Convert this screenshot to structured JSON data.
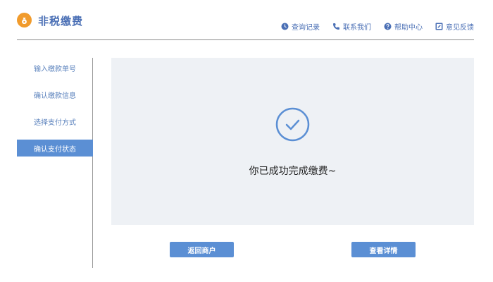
{
  "header": {
    "title": "非税缴费",
    "logo_icon": "money-bag-icon",
    "nav": [
      {
        "label": "查询记录",
        "icon": "clock-icon"
      },
      {
        "label": "联系我们",
        "icon": "phone-icon"
      },
      {
        "label": "帮助中心",
        "icon": "help-icon"
      },
      {
        "label": "意见反馈",
        "icon": "edit-icon"
      }
    ]
  },
  "sidebar": {
    "items": [
      {
        "label": "输入缴款单号",
        "active": false
      },
      {
        "label": "确认缴款信息",
        "active": false
      },
      {
        "label": "选择支付方式",
        "active": false
      },
      {
        "label": "确认支付状态",
        "active": true
      }
    ]
  },
  "main": {
    "status_icon": "check-circle-icon",
    "success_message": "你已成功完成缴费~",
    "buttons": {
      "back_label": "返回商户",
      "detail_label": "查看详情"
    }
  },
  "colors": {
    "brand_blue": "#4a6fb5",
    "active_blue": "#5b8fd4",
    "logo_orange": "#f19b2c",
    "content_bg": "#eef1f5"
  }
}
